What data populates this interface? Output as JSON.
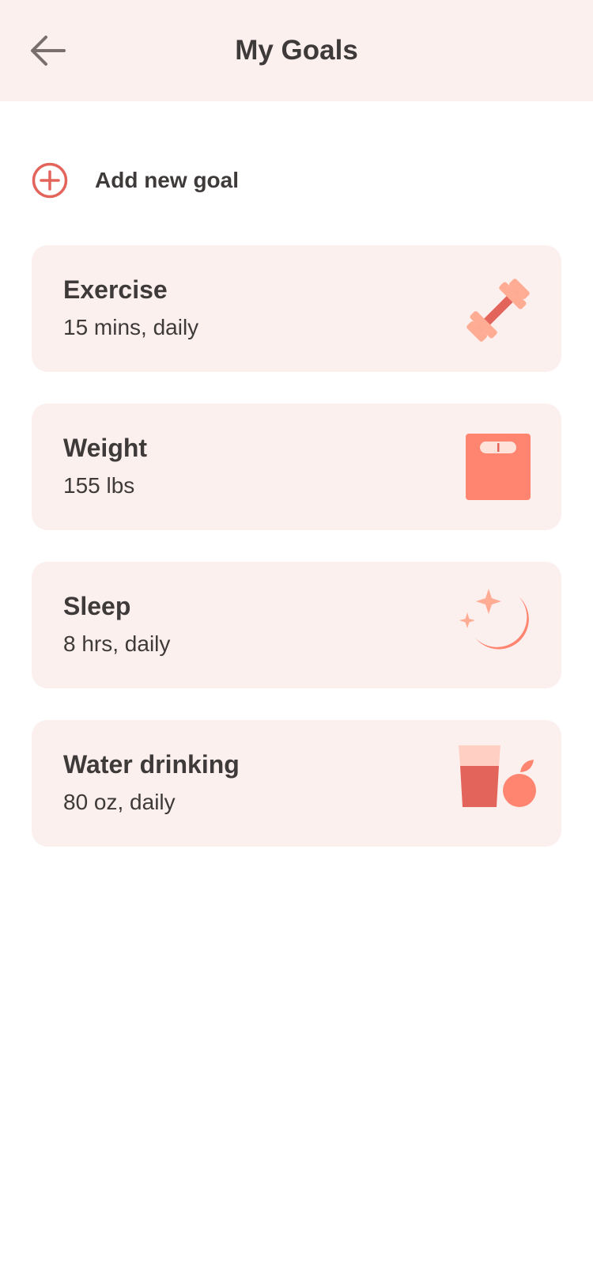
{
  "header": {
    "title": "My Goals",
    "back_icon": "arrow-left-icon"
  },
  "add_goal": {
    "label": "Add new goal",
    "icon": "plus-circle-icon"
  },
  "goals": [
    {
      "title": "Exercise",
      "subtitle": "15 mins, daily",
      "icon": "dumbbell-icon"
    },
    {
      "title": "Weight",
      "subtitle": "155 lbs",
      "icon": "scale-icon"
    },
    {
      "title": "Sleep",
      "subtitle": "8 hrs, daily",
      "icon": "moon-stars-icon"
    },
    {
      "title": "Water drinking",
      "subtitle": "80 oz, daily",
      "icon": "glass-apple-icon"
    }
  ],
  "colors": {
    "accent": "#e3645a",
    "card_background": "#fbf0ee",
    "text": "#3f3a3a",
    "icon_coral": "#ff8571",
    "icon_peach": "#ffac95"
  }
}
